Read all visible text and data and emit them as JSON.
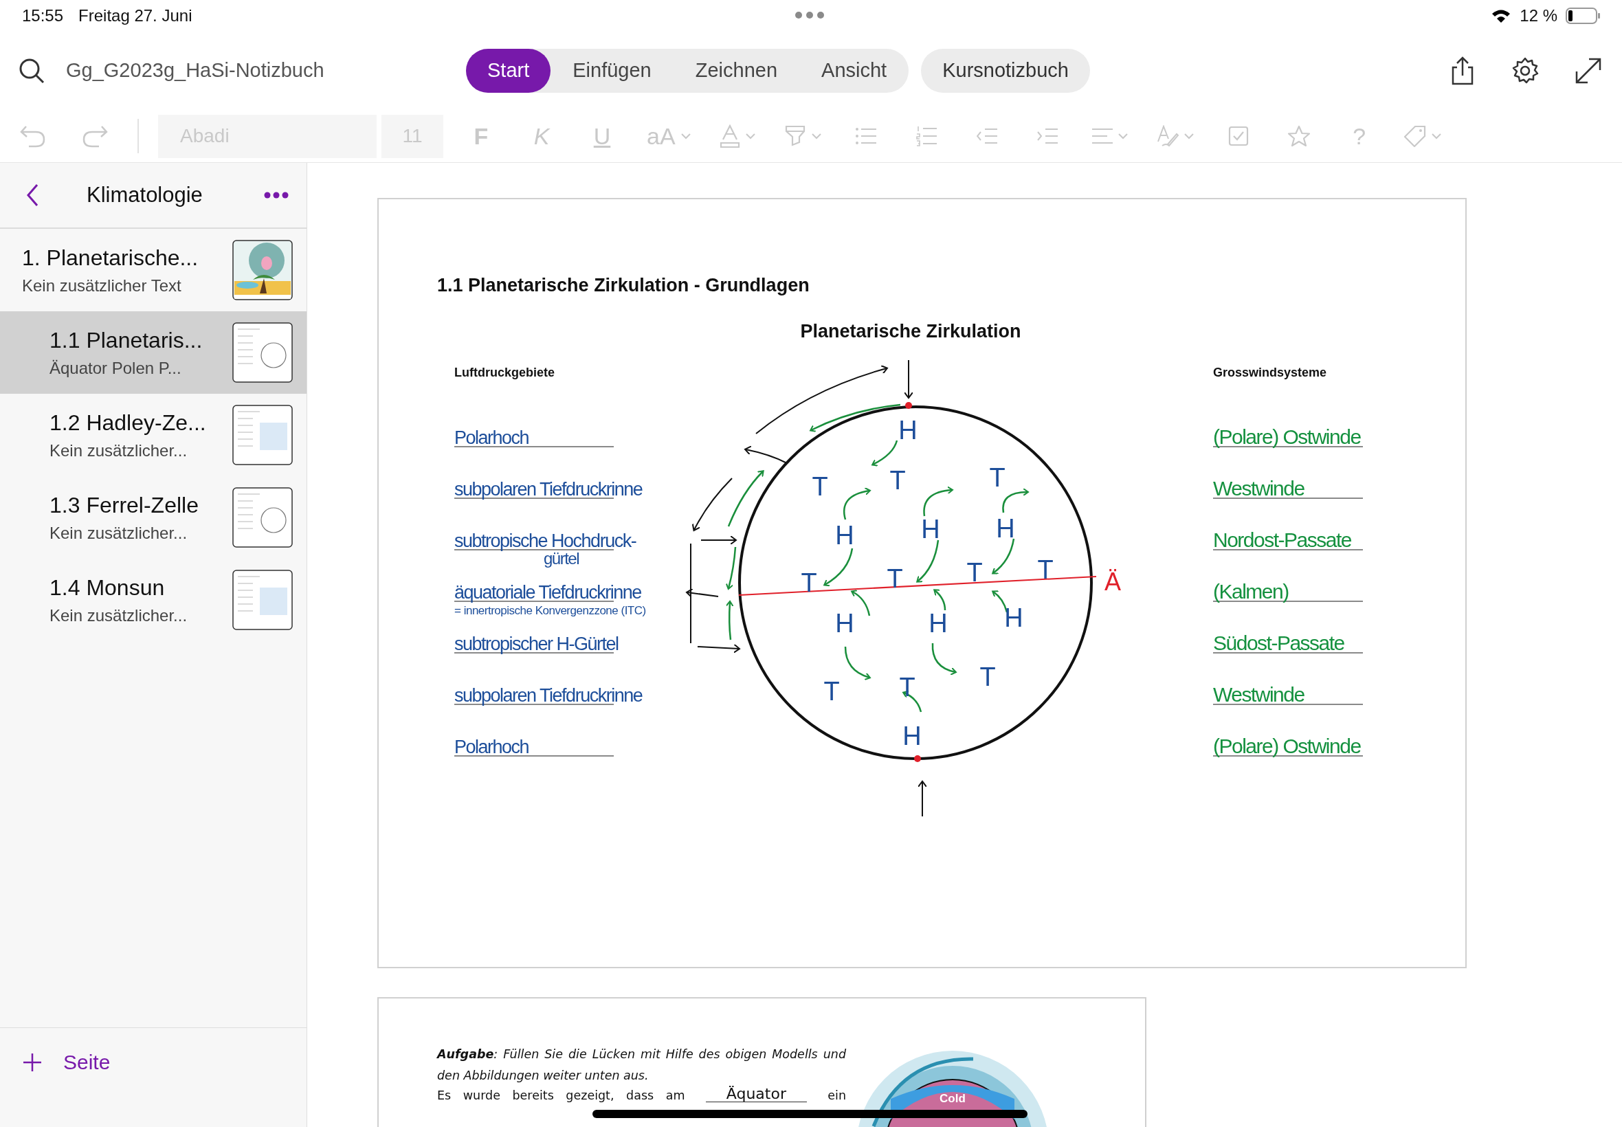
{
  "status_bar": {
    "time": "15:55",
    "date": "Freitag 27. Juni",
    "battery": "12 %"
  },
  "notebook": {
    "title": "Gg_G2023g_HaSi-Notizbuch"
  },
  "tabs": [
    {
      "label": "Start",
      "selected": true
    },
    {
      "label": "Einfügen",
      "selected": false
    },
    {
      "label": "Zeichnen",
      "selected": false
    },
    {
      "label": "Ansicht",
      "selected": false
    }
  ],
  "class_notebook_button": "Kursnotizbuch",
  "format_toolbar": {
    "disabled": true,
    "font": "Abadi",
    "size": "11",
    "tools": [
      {
        "kind": "bold",
        "label": "F",
        "menu": false
      },
      {
        "kind": "italic",
        "label": "K",
        "menu": false
      },
      {
        "kind": "underline",
        "label": "U",
        "menu": false
      },
      {
        "kind": "case",
        "label": "aA",
        "menu": true
      },
      {
        "kind": "font-color",
        "menu": true
      },
      {
        "kind": "highlighter",
        "menu": true
      },
      {
        "kind": "bullets",
        "menu": false
      },
      {
        "kind": "numbering",
        "menu": false
      },
      {
        "kind": "outdent",
        "menu": false
      },
      {
        "kind": "indent",
        "menu": false
      },
      {
        "kind": "align",
        "menu": true
      },
      {
        "kind": "styles",
        "menu": true
      },
      {
        "kind": "checkbox",
        "menu": false
      },
      {
        "kind": "star",
        "menu": false
      },
      {
        "kind": "help",
        "label": "?",
        "menu": false
      },
      {
        "kind": "tag",
        "menu": true
      }
    ]
  },
  "sidebar": {
    "section": "Klimatologie",
    "add_page": "Seite",
    "pages": [
      {
        "title": "1. Planetarische...",
        "preview": "Kein zusätzlicher Text",
        "selected": false,
        "children": [
          {
            "title": "1.1 Planetaris...",
            "preview": "Äquator  Polen  P...",
            "selected": true
          },
          {
            "title": "1.2 Hadley-Ze...",
            "preview": "Kein zusätzlicher...",
            "selected": false
          },
          {
            "title": "1.3 Ferrel-Zelle",
            "preview": "Kein zusätzlicher...",
            "selected": false
          },
          {
            "title": "1.4 Monsun",
            "preview": "Kein zusätzlicher...",
            "selected": false
          }
        ]
      }
    ]
  },
  "page": {
    "heading": "1.1 Planetarische Zirkulation - Grundlagen",
    "diagram": {
      "title": "Planetarische Zirkulation",
      "equator_label": "Ä",
      "letters": [
        "H",
        "T",
        "T",
        "T",
        "H",
        "H",
        "H",
        "T",
        "T",
        "T",
        "T",
        "H",
        "H",
        "H",
        "T",
        "T",
        "T",
        "H"
      ]
    },
    "pressure_areas": {
      "title": "Luftdruckgebiete",
      "answers": [
        {
          "lines": [
            "Polarhoch"
          ]
        },
        {
          "lines": [
            "subpolaren Tiefdruckrinne"
          ]
        },
        {
          "lines": [
            "subtropische Hochdruck-",
            "gürtel"
          ]
        },
        {
          "lines": [
            "äquatoriale Tiefdruckrinne",
            "= innertropische Konvergenzzone (ITC)"
          ]
        },
        {
          "lines": [
            "subtropischer H-Gürtel"
          ]
        },
        {
          "lines": [
            "subpolaren Tiefdruckrinne"
          ]
        },
        {
          "lines": [
            "Polarhoch"
          ]
        }
      ]
    },
    "wind_systems": {
      "title": "Grosswindsysteme",
      "answers": [
        {
          "lines": [
            "(Polare) Ostwinde"
          ]
        },
        {
          "lines": [
            "Westwinde"
          ]
        },
        {
          "lines": [
            "Nordost-Passate"
          ]
        },
        {
          "lines": [
            "(Kalmen)"
          ]
        },
        {
          "lines": [
            "Südost-Passate"
          ]
        },
        {
          "lines": [
            "Westwinde"
          ]
        },
        {
          "lines": [
            "(Polare) Ostwinde"
          ]
        }
      ]
    }
  },
  "next_page": {
    "task": "**Aufgabe**: Füllen Sie die Lücken mit Hilfe des obigen Modells und den Abbildungen weiter unten aus.",
    "sentence_start": "Es wurde bereits gezeigt, dass am",
    "blank_answer": "Äquator",
    "sentence_end": "ein",
    "figure_label": "Cold"
  }
}
